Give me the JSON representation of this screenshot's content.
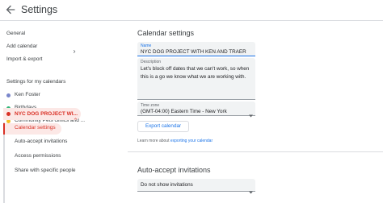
{
  "header": {
    "title": "Settings"
  },
  "sidebar": {
    "items": [
      {
        "label": "General"
      },
      {
        "label": "Add calendar"
      },
      {
        "label": "Import & export"
      }
    ],
    "section_title": "Settings for my calendars",
    "calendars": [
      {
        "label": "Ken Foster",
        "color": "#7986cb"
      },
      {
        "label": "Birthdays",
        "color": "#33b679"
      },
      {
        "label": "Community Pets clinics and ...",
        "color": "#f6bf26"
      },
      {
        "label": "NYC DOG PROJECT WI...",
        "color": "#d93025"
      }
    ],
    "subitems": [
      {
        "label": "Calendar settings"
      },
      {
        "label": "Auto-accept invitations"
      },
      {
        "label": "Access permissions"
      },
      {
        "label": "Share with specific people"
      }
    ]
  },
  "main": {
    "calendar_settings_title": "Calendar settings",
    "name": {
      "label": "Name",
      "value": "NYC DOG PROJECT WITH KEN AND TRAER"
    },
    "description": {
      "label": "Description",
      "value": "Let's block off dates that we can't work, so when this is a go we know what we are working with."
    },
    "timezone": {
      "label": "Time zone",
      "value": "(GMT-04:00) Eastern Time - New York"
    },
    "export_button": "Export calendar",
    "learn_more_prefix": "Learn more about",
    "learn_more_link": "exporting your calendar",
    "auto_accept_title": "Auto-accept invitations",
    "auto_accept_value": "Do not show invitations"
  }
}
